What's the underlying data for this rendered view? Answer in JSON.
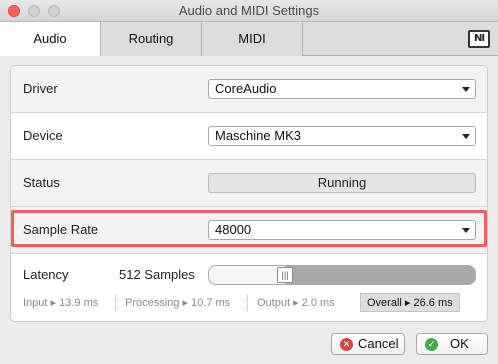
{
  "window": {
    "title": "Audio and MIDI Settings"
  },
  "tabs": [
    {
      "label": "Audio",
      "active": true
    },
    {
      "label": "Routing",
      "active": false
    },
    {
      "label": "MIDI",
      "active": false
    }
  ],
  "brand": {
    "logo_text": "NI"
  },
  "driver": {
    "label": "Driver",
    "value": "CoreAudio"
  },
  "device": {
    "label": "Device",
    "value": "Maschine MK3"
  },
  "status": {
    "label": "Status",
    "value": "Running"
  },
  "sample_rate": {
    "label": "Sample Rate",
    "value": "48000"
  },
  "latency": {
    "label": "Latency",
    "value": "512 Samples",
    "slider_position": 0.27
  },
  "metrics": {
    "input": "Input ▸ 13.9 ms",
    "processing": "Processing ▸ 10.7 ms",
    "output": "Output ▸ 2.0 ms",
    "overall": "Overall ▸ 26.6 ms"
  },
  "buttons": {
    "cancel": "Cancel",
    "ok": "OK"
  },
  "colors": {
    "highlight": "#f1605e",
    "cancel_icon": "#d9443f",
    "ok_icon": "#3fae49"
  },
  "icons": {
    "cancel": "x-circle-icon",
    "ok": "check-circle-icon",
    "dropdown": "chevron-down-icon"
  }
}
